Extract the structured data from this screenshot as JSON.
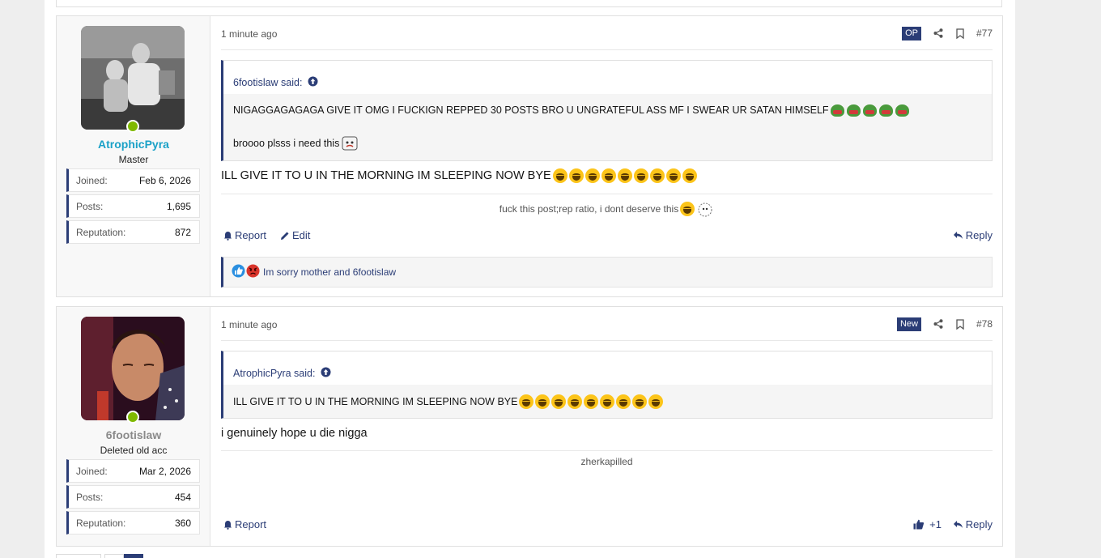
{
  "posts": [
    {
      "time": "1 minute ago",
      "badge": "OP",
      "number": "#77",
      "user": {
        "name": "AtrophicPyra",
        "title": "Master",
        "stats": [
          {
            "key": "Joined:",
            "value": "Feb 6, 2026"
          },
          {
            "key": "Posts:",
            "value": "1,695"
          },
          {
            "key": "Reputation:",
            "value": "872"
          }
        ]
      },
      "quote": {
        "author_label": "6footislaw said:",
        "lines": [
          "NIGAGGAGAGAGA GIVE IT OMG I FUCKIGN REPPED 30 POSTS BRO U UNGRATEFUL ASS MF I SWEAR UR SATAN HIMSELF",
          "broooo plsss i need this"
        ]
      },
      "message": "ILL GIVE IT TO U IN THE MORNING IM SLEEPING NOW BYE",
      "signature": "fuck this post;rep ratio, i dont deserve this",
      "actions": {
        "report": "Report",
        "edit": "Edit",
        "reply": "Reply"
      },
      "reactions_text": "Im sorry mother and 6footislaw"
    },
    {
      "time": "1 minute ago",
      "badge": "New",
      "number": "#78",
      "user": {
        "name": "6footislaw",
        "title": "Deleted old acc",
        "stats": [
          {
            "key": "Joined:",
            "value": "Mar 2, 2026"
          },
          {
            "key": "Posts:",
            "value": "454"
          },
          {
            "key": "Reputation:",
            "value": "360"
          }
        ]
      },
      "quote": {
        "author_label": "AtrophicPyra said:",
        "lines": [
          "ILL GIVE IT TO U IN THE MORNING IM SLEEPING NOW BYE"
        ]
      },
      "message": "i genuinely hope u die nigga",
      "signature": "zherkapilled",
      "actions": {
        "report": "Report",
        "reply": "Reply",
        "like_count": "+1"
      }
    }
  ],
  "icons": [
    "share-icon",
    "bookmark-icon",
    "bell-icon",
    "pencil-icon",
    "reply-icon",
    "thumbs-up-icon",
    "arrow-up-circle-icon",
    "laughing-crying-emoji",
    "pepe-emoji"
  ],
  "colors": {
    "accent": "#2b3d76",
    "username_active": "#1aa1c7",
    "online": "#7fb900",
    "background": "#eeeeee"
  }
}
